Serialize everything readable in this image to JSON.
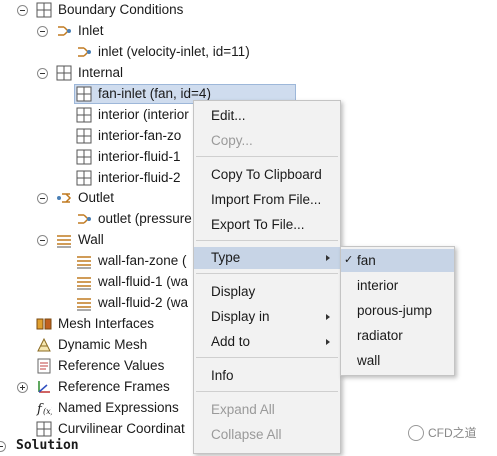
{
  "tree": {
    "boundary_conditions": "Boundary Conditions",
    "inlet": "Inlet",
    "inlet_child": "inlet (velocity-inlet, id=11)",
    "internal": "Internal",
    "fan_inlet": "fan-inlet (fan, id=4)",
    "interior": "interior (interior",
    "interior_fan_zone": "interior-fan-zo",
    "interior_fluid_1": "interior-fluid-1",
    "interior_fluid_2": "interior-fluid-2",
    "outlet": "Outlet",
    "outlet_child": "outlet (pressure",
    "wall": "Wall",
    "wall_fan_zone": "wall-fan-zone (",
    "wall_fluid_1": "wall-fluid-1 (wa",
    "wall_fluid_2": "wall-fluid-2 (wa",
    "mesh_interfaces": "Mesh Interfaces",
    "dynamic_mesh": "Dynamic Mesh",
    "reference_values": "Reference Values",
    "reference_frames": "Reference Frames",
    "named_expressions": "Named Expressions",
    "curvilinear": "Curvilinear Coordinat",
    "solution": "Solution"
  },
  "context_menu": {
    "edit": "Edit...",
    "copy": "Copy...",
    "copy_to_clipboard": "Copy To Clipboard",
    "import_from_file": "Import From File...",
    "export_to_file": "Export To File...",
    "type": "Type",
    "display": "Display",
    "display_in": "Display in",
    "add_to": "Add to",
    "info": "Info",
    "expand_all": "Expand All",
    "collapse_all": "Collapse All"
  },
  "type_submenu": {
    "checked": "✓",
    "options": [
      "fan",
      "interior",
      "porous-jump",
      "radiator",
      "wall"
    ]
  },
  "watermark": "CFD之道",
  "colors": {
    "selection": "#cfdcee",
    "menu_bg": "#f2f2f2",
    "menu_highlight": "#c7d4e6"
  }
}
